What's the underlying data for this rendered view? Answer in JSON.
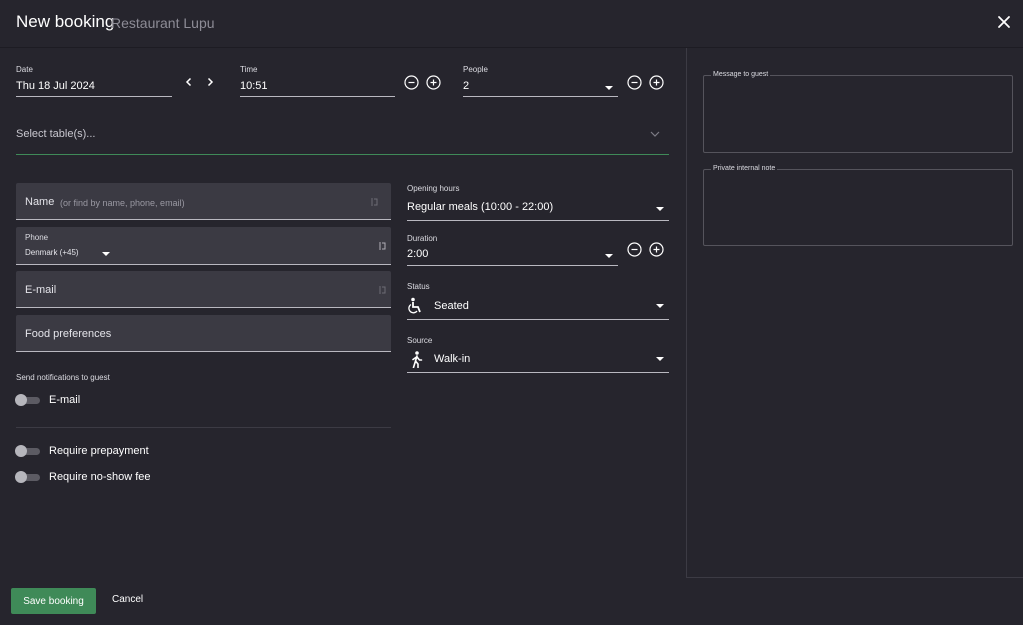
{
  "header": {
    "title": "New booking",
    "subtitle": "Restaurant Lupu"
  },
  "date": {
    "label": "Date",
    "value": "Thu 18 Jul 2024"
  },
  "time": {
    "label": "Time",
    "value": "10:51"
  },
  "people": {
    "label": "People",
    "value": "2"
  },
  "tables": {
    "placeholder": "Select table(s)..."
  },
  "name": {
    "label": "Name",
    "hint": "(or find by name, phone, email)"
  },
  "phone": {
    "label": "Phone",
    "country": "Denmark (+45)"
  },
  "email_field": {
    "label": "E-mail"
  },
  "food": {
    "label": "Food preferences"
  },
  "notifications": {
    "heading": "Send notifications to guest",
    "email_label": "E-mail"
  },
  "prepayment": {
    "label": "Require prepayment"
  },
  "noshow": {
    "label": "Require no-show fee"
  },
  "opening_hours": {
    "label": "Opening hours",
    "value": "Regular meals (10:00 - 22:00)"
  },
  "duration": {
    "label": "Duration",
    "value": "2:00"
  },
  "status": {
    "label": "Status",
    "value": "Seated"
  },
  "source": {
    "label": "Source",
    "value": "Walk-in"
  },
  "message": {
    "label": "Message to guest"
  },
  "private_note": {
    "label": "Private internal note"
  },
  "footer": {
    "save_label": "Save booking",
    "cancel_label": "Cancel"
  },
  "colors": {
    "accent": "#3f8a58",
    "background": "#26252d",
    "field": "#3b3a43"
  },
  "icons": [
    "close-icon",
    "chevron-left-icon",
    "chevron-right-icon",
    "minus-circle-icon",
    "plus-circle-icon",
    "chevron-down-icon",
    "contact-icon",
    "wheelchair-seated-icon",
    "walking-person-icon"
  ]
}
